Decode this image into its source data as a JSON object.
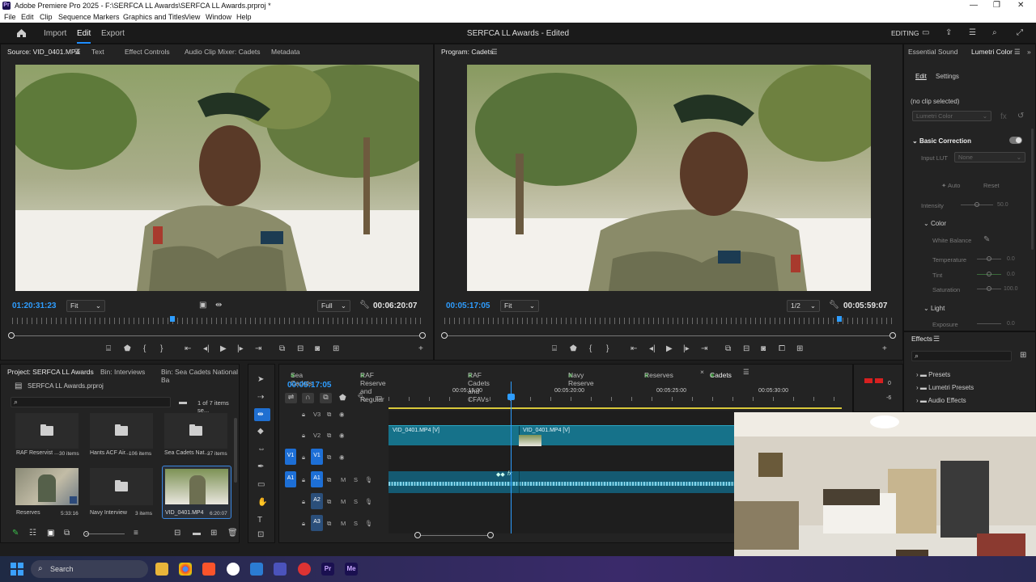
{
  "window": {
    "title": "Adobe Premiere Pro 2025 - F:\\SERFCA LL Awards\\SERFCA LL Awards.prproj *",
    "logo": "Pr",
    "minimize": "—",
    "maximize": "❐",
    "close": "✕"
  },
  "menu": [
    "File",
    "Edit",
    "Clip",
    "Sequence",
    "Markers",
    "Graphics and Titles",
    "View",
    "Window",
    "Help"
  ],
  "header": {
    "tabs": {
      "import": "Import",
      "edit": "Edit",
      "export": "Export"
    },
    "project_title": "SERFCA LL Awards - Edited",
    "workspace": "EDITING"
  },
  "source": {
    "tabs": {
      "source": "Source: VID_0401.MP4",
      "text": "Text",
      "effect_controls": "Effect Controls",
      "audio_mixer": "Audio Clip Mixer: Cadets",
      "metadata": "Metadata"
    },
    "timecode_in": "01:20:31:23",
    "fit": "Fit",
    "quality": "Full",
    "duration": "00:06:20:07",
    "playhead_fraction": 0.39
  },
  "program": {
    "tab": "Program: Cadets",
    "timecode": "00:05:17:05",
    "fit": "Fit",
    "quality": "1/2",
    "duration": "00:05:59:07",
    "playhead_fraction": 0.88
  },
  "lumetri": {
    "tabs": {
      "essential_sound": "Essential Sound",
      "lumetri": "Lumetri Color"
    },
    "subtabs": {
      "edit": "Edit",
      "settings": "Settings"
    },
    "no_clip": "(no clip selected)",
    "effect_select": "Lumetri Color",
    "basic_correction": "Basic Correction",
    "input_lut_label": "Input LUT",
    "input_lut_value": "None",
    "auto": "Auto",
    "reset": "Reset",
    "intensity_label": "Intensity",
    "intensity_value": "50.0",
    "color_section": "Color",
    "white_balance": "White Balance",
    "temperature_label": "Temperature",
    "temperature_value": "0.0",
    "tint_label": "Tint",
    "tint_value": "0.0",
    "saturation_label": "Saturation",
    "saturation_value": "100.0",
    "light_section": "Light",
    "exposure_label": "Exposure",
    "exposure_value": "0.0"
  },
  "effects": {
    "title": "Effects",
    "items": [
      "Presets",
      "Lumetri Presets",
      "Audio Effects"
    ]
  },
  "project": {
    "tabs": {
      "project": "Project: SERFCA LL Awards",
      "bin1": "Bin: Interviews",
      "bin2": "Bin: Sea Cadets National Ba"
    },
    "file": "SERFCA LL Awards.prproj",
    "selection_count": "1 of 7 items se...",
    "items": [
      {
        "name": "RAF Reservist ...",
        "meta": "30 items"
      },
      {
        "name": "Hants ACF Air...",
        "meta": "106 items"
      },
      {
        "name": "Sea Cadets Nat...",
        "meta": "37 items"
      },
      {
        "name": "Reserves",
        "meta": "5:33:16"
      },
      {
        "name": "Navy Interview",
        "meta": "3 items"
      },
      {
        "name": "VID_0401.MP4",
        "meta": "6:20:07"
      }
    ]
  },
  "timeline": {
    "tabs": [
      "Sea Cadets",
      "RAF Reserve and Regular",
      "RAF Cadets and CFAVs",
      "Navy Reserve",
      "Reserves",
      "Cadets"
    ],
    "timecode": "00:05:17:05",
    "ruler_labels": [
      "00:05:15:00",
      "00:05:20:00",
      "00:05:25:00",
      "00:05:30:00"
    ],
    "tracks": {
      "v3": "V3",
      "v2": "V2",
      "v1": "V1",
      "a1": "A1",
      "a2": "A2",
      "a3": "A3",
      "src_v1": "V1",
      "src_a1": "A1",
      "m": "M",
      "s": "S"
    },
    "clip_label": "VID_0401.MP4 [V]",
    "meter_labels": [
      "0",
      "-6"
    ]
  },
  "taskbar": {
    "search": "Search"
  },
  "colors": {
    "accent": "#2e9dff",
    "clip_video": "#16728a",
    "clip_audio": "#145a72"
  }
}
